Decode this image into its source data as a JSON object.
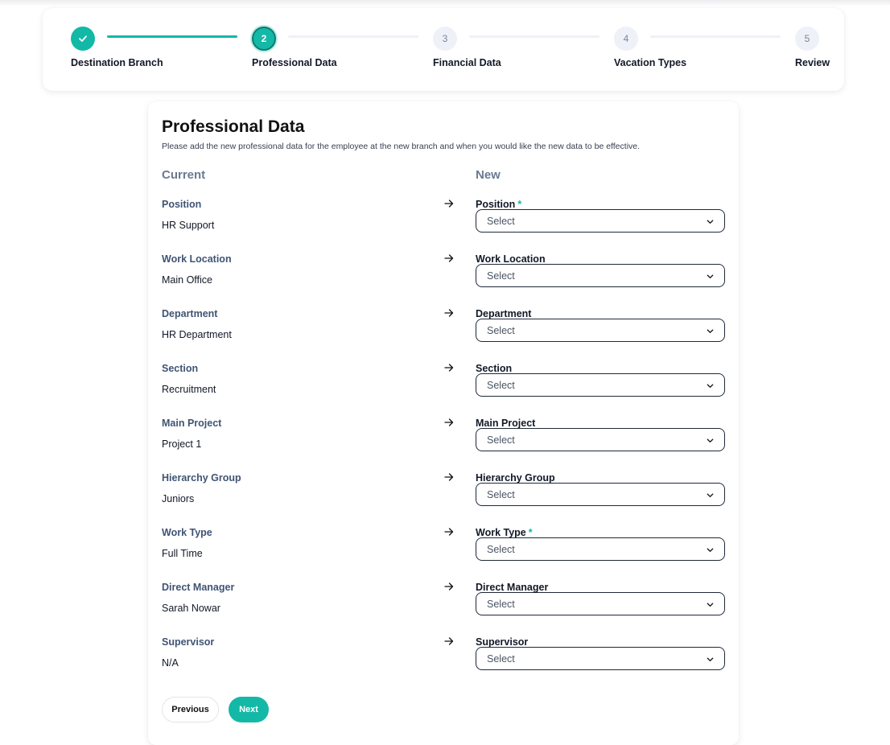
{
  "stepper": {
    "steps": [
      {
        "number": "1",
        "label": "Destination Branch",
        "state": "done"
      },
      {
        "number": "2",
        "label": "Professional Data",
        "state": "active"
      },
      {
        "number": "3",
        "label": "Financial Data",
        "state": "todo"
      },
      {
        "number": "4",
        "label": "Vacation Types",
        "state": "todo"
      },
      {
        "number": "5",
        "label": "Review",
        "state": "todo"
      }
    ]
  },
  "form": {
    "title": "Professional Data",
    "subtitle": "Please add the new professional data for the employee at the new branch and when you would like the new data to be effective.",
    "current_heading": "Current",
    "new_heading": "New",
    "rows": [
      {
        "label": "Position",
        "current": "HR Support",
        "new_label": "Position",
        "required": true,
        "placeholder": "Select"
      },
      {
        "label": "Work Location",
        "current": "Main Office",
        "new_label": "Work Location",
        "required": false,
        "placeholder": "Select"
      },
      {
        "label": "Department",
        "current": "HR Department",
        "new_label": "Department",
        "required": false,
        "placeholder": "Select"
      },
      {
        "label": "Section",
        "current": "Recruitment",
        "new_label": "Section",
        "required": false,
        "placeholder": "Select"
      },
      {
        "label": "Main Project",
        "current": "Project 1",
        "new_label": "Main Project",
        "required": false,
        "placeholder": "Select"
      },
      {
        "label": "Hierarchy Group",
        "current": "Juniors",
        "new_label": "Hierarchy Group",
        "required": false,
        "placeholder": "Select"
      },
      {
        "label": "Work Type",
        "current": "Full Time",
        "new_label": "Work Type",
        "required": true,
        "placeholder": "Select"
      },
      {
        "label": "Direct Manager",
        "current": "Sarah Nowar",
        "new_label": "Direct Manager",
        "required": false,
        "placeholder": "Select"
      },
      {
        "label": "Supervisor",
        "current": "N/A",
        "new_label": "Supervisor",
        "required": false,
        "placeholder": "Select"
      }
    ],
    "required_mark": "*",
    "previous_label": "Previous",
    "next_label": "Next"
  },
  "icons": {
    "step_done": "check-icon",
    "row_arrow": "arrow-right-icon",
    "select_caret": "chevron-down-icon"
  },
  "colors": {
    "accent": "#14b8a6",
    "label_muted": "#3f5474",
    "heading_muted": "#6b7a90",
    "step_inactive": "#eef1f7"
  }
}
